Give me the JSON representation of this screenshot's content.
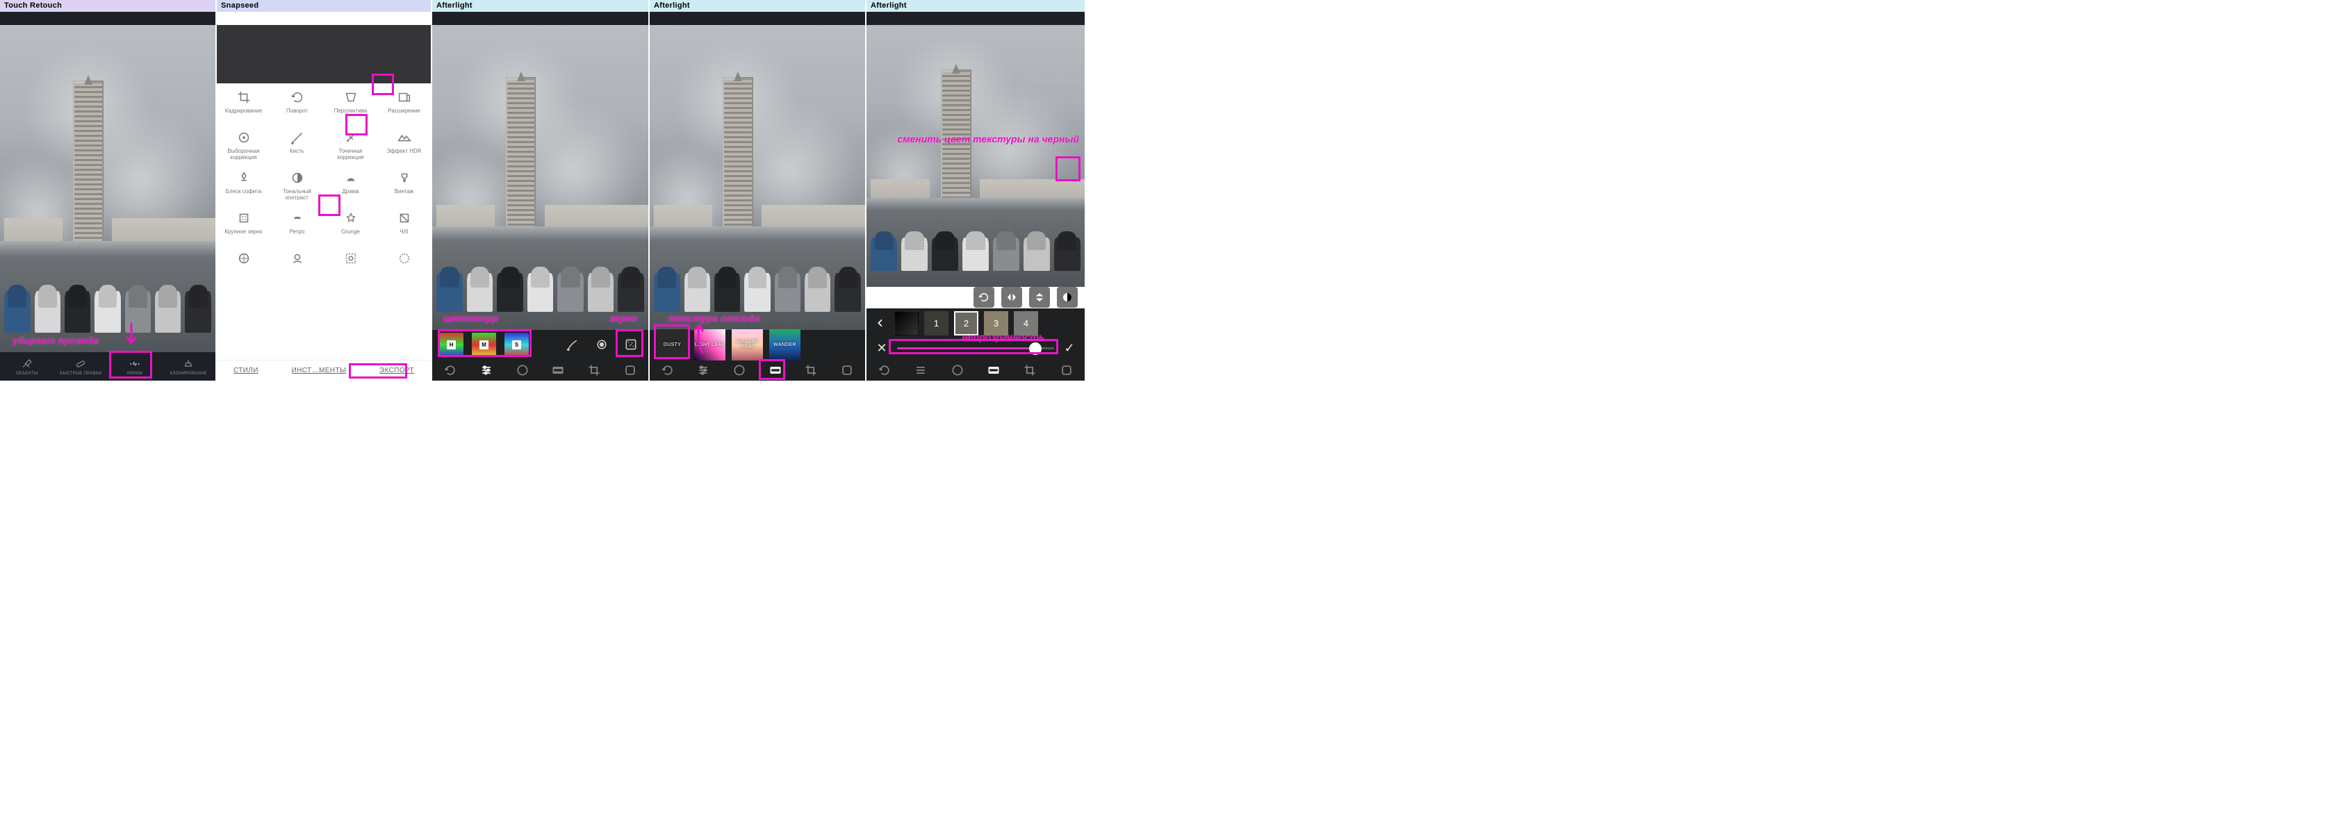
{
  "panels": {
    "p1": {
      "title": "Touch Retouch"
    },
    "p2": {
      "title": "Snapseed"
    },
    "p3": {
      "title": "Afterlight"
    },
    "p4": {
      "title": "Afterlight"
    },
    "p5": {
      "title": "Afterlight"
    }
  },
  "colors": {
    "highlight": "#ed10c6"
  },
  "touch_retouch": {
    "tools": [
      {
        "label": "ОБЪЕКТЫ"
      },
      {
        "label": "БЫСТРЫЕ ПРАВКИ"
      },
      {
        "label": "ЛИНИИ"
      },
      {
        "label": "КЛОНИРОВАНИЕ"
      }
    ],
    "annotation": "убирает провода"
  },
  "snapseed": {
    "tabs": {
      "styles": "СТИЛИ",
      "tools": "ИНСТ…МЕНТЫ",
      "export": "ЭКСПОРТ"
    },
    "tools": [
      [
        {
          "label": "Кадрирование"
        },
        {
          "label": "Поворот"
        },
        {
          "label": "Перспектива"
        },
        {
          "label": "Расширение"
        }
      ],
      [
        {
          "label": "Выборочная коррекция"
        },
        {
          "label": "Кисть"
        },
        {
          "label": "Точечная коррекция"
        },
        {
          "label": "Эффект HDR"
        }
      ],
      [
        {
          "label": "Блеск софита"
        },
        {
          "label": "Тональный контраст"
        },
        {
          "label": "Драма"
        },
        {
          "label": "Винтаж"
        }
      ],
      [
        {
          "label": "Крупное зерно"
        },
        {
          "label": "Ретро"
        },
        {
          "label": "Grunge"
        },
        {
          "label": "Ч/б"
        }
      ],
      [
        {
          "label": ""
        },
        {
          "label": ""
        },
        {
          "label": ""
        },
        {
          "label": ""
        }
      ]
    ]
  },
  "afterlight3": {
    "annotations": {
      "color": "цветокорр",
      "grain": "зерно"
    },
    "thumbs": {
      "h": "H",
      "m": "M",
      "s": "S"
    }
  },
  "afterlight4": {
    "annotation": "текстура отсюда",
    "filters": [
      "DUSTY",
      "LIGHT LEAK",
      "INSTANT FILM",
      "WANDER"
    ]
  },
  "afterlight5": {
    "annotations": {
      "invert": "сменить цвет текстуры на черный",
      "opacity": "непрозрачность"
    },
    "thumbs": [
      "1",
      "2",
      "3",
      "4"
    ]
  }
}
